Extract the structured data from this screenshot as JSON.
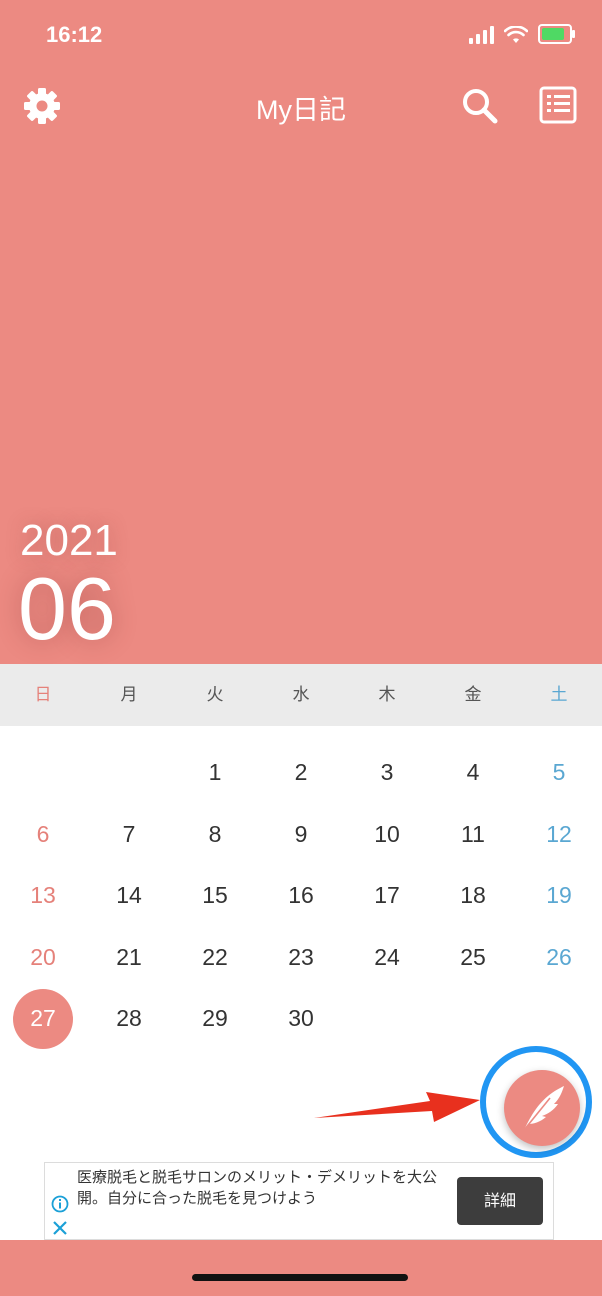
{
  "status": {
    "time": "16:12"
  },
  "header": {
    "title": "My日記",
    "year": "2021",
    "month": "06"
  },
  "weekdays": [
    "日",
    "月",
    "火",
    "水",
    "木",
    "金",
    "土"
  ],
  "calendar": {
    "weeks": [
      [
        "",
        "",
        "1",
        "2",
        "3",
        "4",
        "5"
      ],
      [
        "6",
        "7",
        "8",
        "9",
        "10",
        "11",
        "12"
      ],
      [
        "13",
        "14",
        "15",
        "16",
        "17",
        "18",
        "19"
      ],
      [
        "20",
        "21",
        "22",
        "23",
        "24",
        "25",
        "26"
      ],
      [
        "27",
        "28",
        "29",
        "30",
        "",
        "",
        ""
      ]
    ],
    "today": "27"
  },
  "ad": {
    "text": "医療脱毛と脱毛サロンのメリット・デメリットを大公開。自分に合った脱毛を見つけよう",
    "button_label": "詳細"
  },
  "colors": {
    "accent": "#ec8a82",
    "sunday": "#e5817a",
    "saturday": "#5aa7d2",
    "highlight_ring": "#2196f3",
    "arrow": "#e8301e"
  },
  "icons": {
    "settings": "gear-icon",
    "search": "search-icon",
    "list": "list-icon",
    "compose": "feather-pen-icon",
    "ad_info": "info-icon",
    "ad_close": "close-icon"
  }
}
